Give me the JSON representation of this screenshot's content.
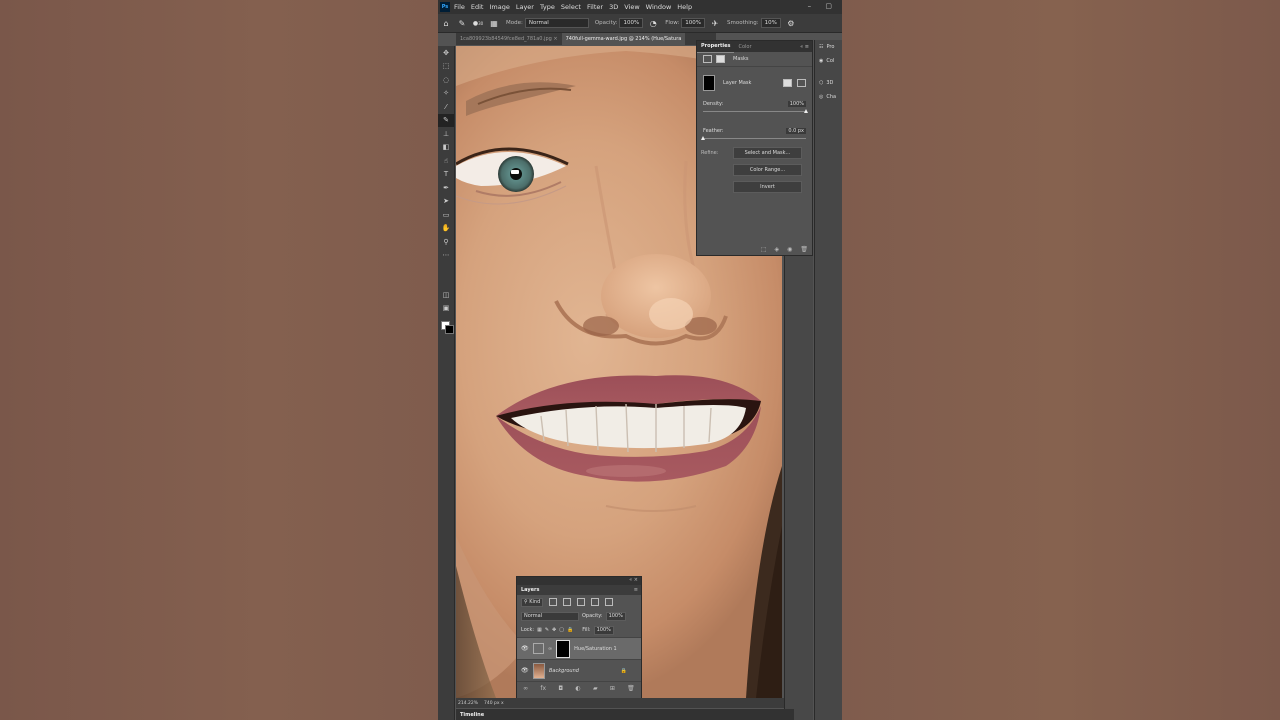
{
  "menu": [
    "File",
    "Edit",
    "Image",
    "Layer",
    "Type",
    "Select",
    "Filter",
    "3D",
    "View",
    "Window",
    "Help"
  ],
  "app_logo": "Ps",
  "options": {
    "mode_label": "Mode:",
    "mode_value": "Normal",
    "opacity_label": "Opacity:",
    "opacity_value": "100%",
    "flow_label": "Flow:",
    "flow_value": "100%",
    "smoothing_label": "Smoothing:",
    "smoothing_value": "10%",
    "brush_size": "30"
  },
  "tabs": [
    {
      "label": "1ca809923b84549fce8ed_781a0.jpg",
      "close": "×"
    },
    {
      "label": "740full-gemma-ward.jpg @ 214% (Hue/Satura",
      "close": ""
    }
  ],
  "properties": {
    "tab": "Properties",
    "tab2": "Color",
    "close": "«  ≡",
    "masks_label": "Masks",
    "layer_mask_label": "Layer Mask",
    "density_label": "Density:",
    "density_value": "100%",
    "feather_label": "Feather:",
    "feather_value": "0.0 px",
    "refine_label": "Refine:",
    "btn_select_mask": "Select and Mask...",
    "btn_color_range": "Color Range...",
    "btn_invert": "Invert"
  },
  "right_panel": [
    "Pro",
    "Col",
    "3D",
    "Cha"
  ],
  "layers": {
    "title": "Layers",
    "kind_label": "Kind",
    "blend": "Normal",
    "opacity_label": "Opacity:",
    "opacity_value": "100%",
    "lock_label": "Lock:",
    "fill_label": "Fill:",
    "fill_value": "100%",
    "items": [
      {
        "name": "Hue/Saturation 1",
        "selected": true
      },
      {
        "name": "Background",
        "selected": false
      }
    ]
  },
  "status": {
    "zoom": "214.22%",
    "size": "740 px x"
  },
  "timeline": "Timeline",
  "colors": {
    "ui_dark": "#323232",
    "panel": "#535353",
    "accent": "#31a8ff"
  }
}
